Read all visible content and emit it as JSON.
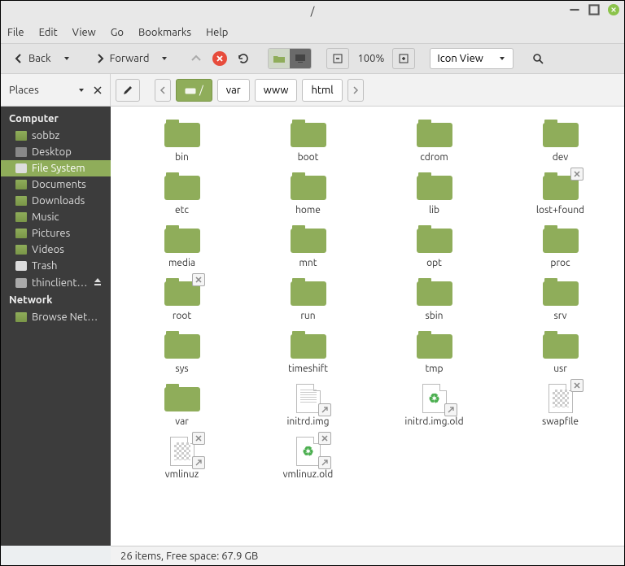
{
  "window": {
    "title": "/"
  },
  "menubar": [
    "File",
    "Edit",
    "View",
    "Go",
    "Bookmarks",
    "Help"
  ],
  "toolbar": {
    "back_label": "Back",
    "forward_label": "Forward",
    "zoom_label": "100%",
    "view_mode": "Icon View"
  },
  "places_header": "Places",
  "path": {
    "crumbs": [
      {
        "label": "/",
        "active": true,
        "icon": true
      },
      {
        "label": "var"
      },
      {
        "label": "www"
      },
      {
        "label": "html"
      }
    ]
  },
  "sidebar": {
    "sections": [
      {
        "heading": "Computer",
        "items": [
          {
            "label": "sobbz",
            "icon": "folder"
          },
          {
            "label": "Desktop",
            "icon": "grey"
          },
          {
            "label": "File System",
            "icon": "drive-light",
            "selected": true
          },
          {
            "label": "Documents",
            "icon": "folder"
          },
          {
            "label": "Downloads",
            "icon": "folder"
          },
          {
            "label": "Music",
            "icon": "folder"
          },
          {
            "label": "Pictures",
            "icon": "folder"
          },
          {
            "label": "Videos",
            "icon": "folder"
          },
          {
            "label": "Trash",
            "icon": "drive-light"
          },
          {
            "label": "thinclient_d…",
            "icon": "drive",
            "eject": true
          }
        ]
      },
      {
        "heading": "Network",
        "items": [
          {
            "label": "Browse Network",
            "icon": "folder"
          }
        ]
      }
    ]
  },
  "files": [
    {
      "name": "bin",
      "type": "folder"
    },
    {
      "name": "boot",
      "type": "folder"
    },
    {
      "name": "cdrom",
      "type": "folder"
    },
    {
      "name": "dev",
      "type": "folder"
    },
    {
      "name": "etc",
      "type": "folder"
    },
    {
      "name": "home",
      "type": "folder"
    },
    {
      "name": "lib",
      "type": "folder"
    },
    {
      "name": "lost+found",
      "type": "folder",
      "emblem_noaccess": true
    },
    {
      "name": "media",
      "type": "folder"
    },
    {
      "name": "mnt",
      "type": "folder"
    },
    {
      "name": "opt",
      "type": "folder"
    },
    {
      "name": "proc",
      "type": "folder"
    },
    {
      "name": "root",
      "type": "folder",
      "emblem_noaccess": true
    },
    {
      "name": "run",
      "type": "folder"
    },
    {
      "name": "sbin",
      "type": "folder"
    },
    {
      "name": "srv",
      "type": "folder"
    },
    {
      "name": "sys",
      "type": "folder"
    },
    {
      "name": "timeshift",
      "type": "folder"
    },
    {
      "name": "tmp",
      "type": "folder"
    },
    {
      "name": "usr",
      "type": "folder"
    },
    {
      "name": "var",
      "type": "folder"
    },
    {
      "name": "initrd.img",
      "type": "file-lines",
      "emblem_link": true
    },
    {
      "name": "initrd.img.old",
      "type": "file-recycle",
      "emblem_link": true
    },
    {
      "name": "swapfile",
      "type": "file-checker",
      "emblem_noaccess": true
    },
    {
      "name": "vmlinuz",
      "type": "file-checker",
      "emblem_link": true,
      "emblem_noaccess": true
    },
    {
      "name": "vmlinuz.old",
      "type": "file-recycle",
      "emblem_link": true,
      "emblem_noaccess": true
    }
  ],
  "statusbar": "26 items, Free space: 67.9 GB"
}
